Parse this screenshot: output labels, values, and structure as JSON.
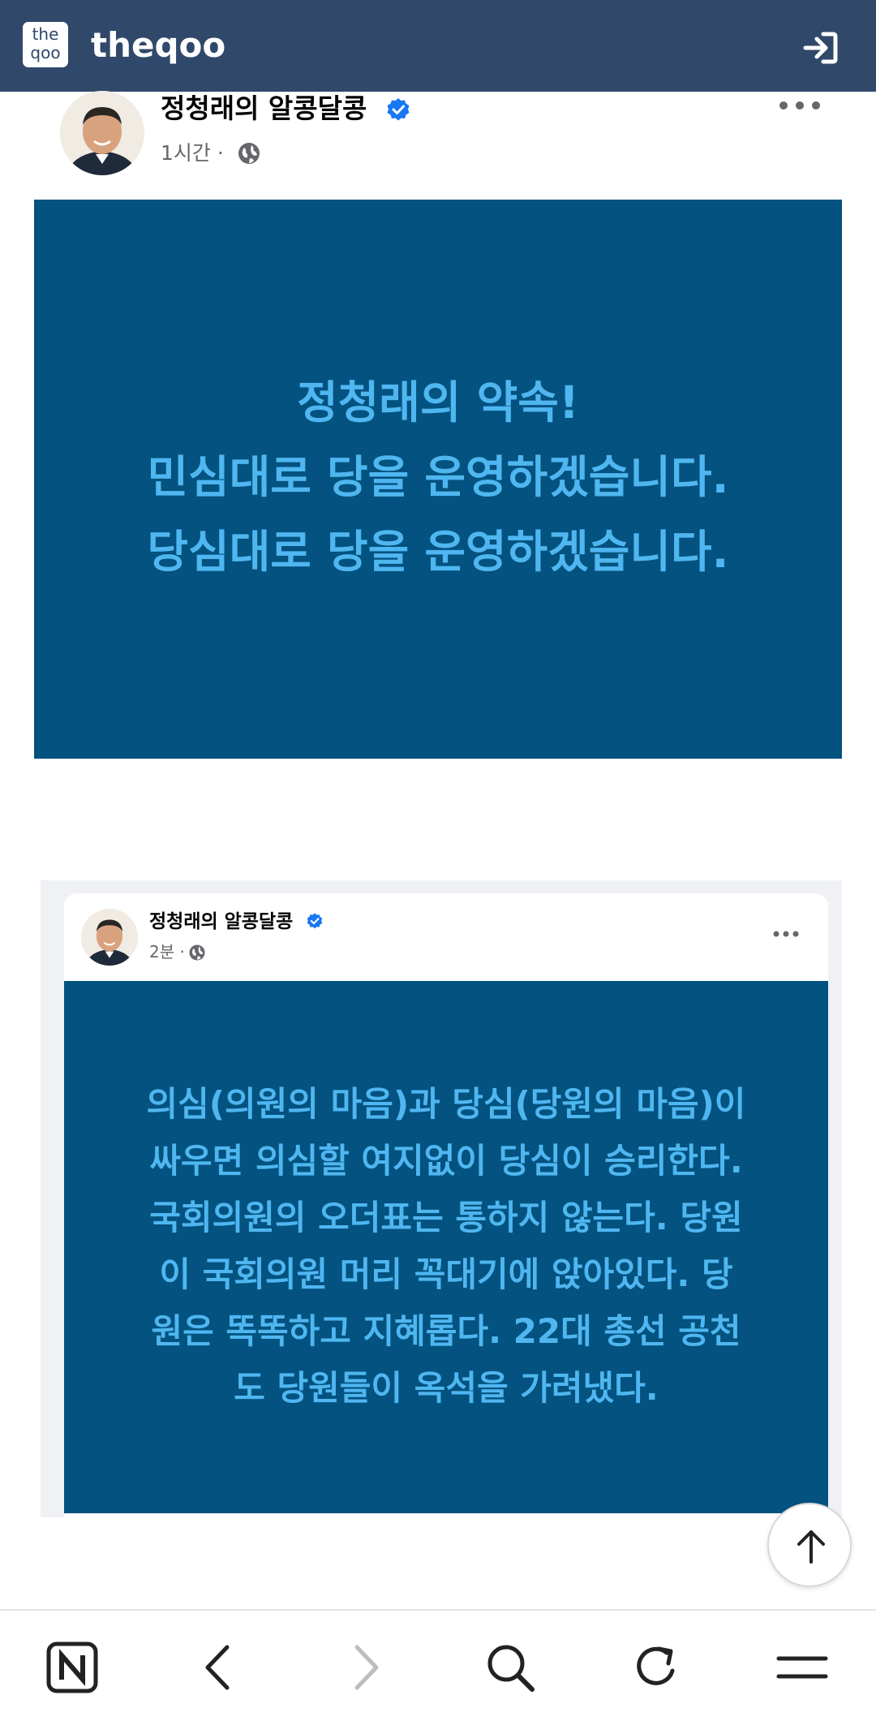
{
  "app": {
    "logo_line1": "the",
    "logo_line2": "qoo",
    "brand": "theqoo"
  },
  "post": {
    "author": "정청래의 알콩달콩",
    "time": "1시간 ·",
    "image_lines": [
      "정청래의 약속!",
      "민심대로 당을 운영하겠습니다.",
      "당심대로 당을 운영하겠습니다."
    ]
  },
  "embedded_post": {
    "author": "정청래의 알콩달콩",
    "time": "2분 ·",
    "image_lines": [
      "의심(의원의 마음)과 당심(당원의 마음)이",
      "싸우면 의심할 여지없이 당심이 승리한다.",
      "국회의원의 오더표는 통하지 않는다. 당원",
      "이 국회의원 머리 꼭대기에 앉아있다. 당",
      "원은 똑똑하고 지혜롭다. 22대 총선 공천",
      "도 당원들이 옥석을 가려냈다."
    ]
  },
  "colors": {
    "topbar": "#30486a",
    "image_bg": "#03527f",
    "image_text": "#4fb6f0",
    "verified": "#1877f2"
  },
  "icons": {
    "login": "login-icon",
    "verified": "verified-badge-icon",
    "globe": "globe-icon",
    "more": "more-options-icon",
    "scroll_top": "arrow-up-icon",
    "nav": [
      "naver-n-icon",
      "back-icon",
      "forward-icon",
      "search-icon",
      "refresh-icon",
      "menu-icon"
    ]
  }
}
